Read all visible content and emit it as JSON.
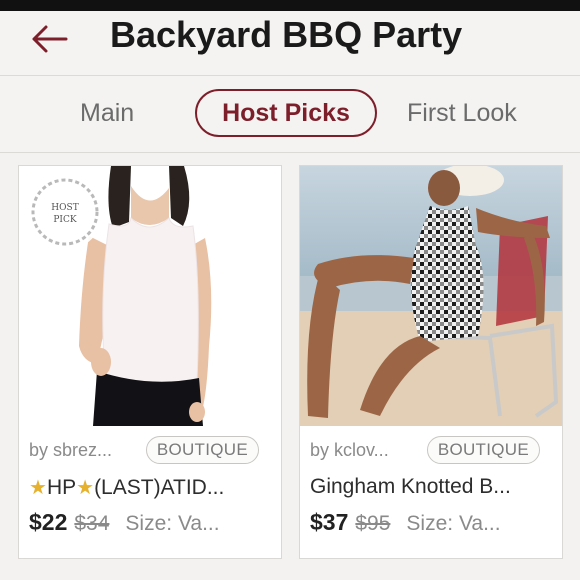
{
  "header": {
    "title": "Backyard BBQ Party",
    "back_icon": "back-arrow-icon"
  },
  "tabs": [
    {
      "label": "Main"
    },
    {
      "label": "Host Picks",
      "active": true
    },
    {
      "label": "First Look"
    }
  ],
  "listings": [
    {
      "seller": "by sbrez...",
      "badge": "BOUTIQUE",
      "host_pick_badge": {
        "line1": "HOST",
        "line2": "PICK"
      },
      "title_prefix_icon": "star-icon",
      "title_text_1": "HP",
      "title_text_2": "(LAST)ATID...",
      "price": "$22",
      "original_price": "$34",
      "size": "Size: Va..."
    },
    {
      "seller": "by kclov...",
      "badge": "BOUTIQUE",
      "title": "Gingham Knotted B...",
      "price": "$37",
      "original_price": "$95",
      "size": "Size: Va..."
    }
  ],
  "colors": {
    "accent": "#7d1f2b",
    "background": "#f3f2f0"
  }
}
